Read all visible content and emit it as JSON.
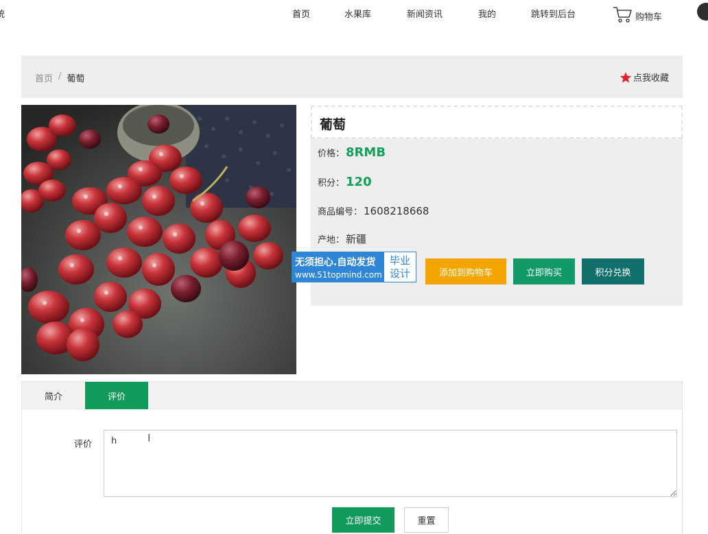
{
  "header": {
    "site_edge": "统",
    "nav": [
      {
        "label": "首页"
      },
      {
        "label": "水果库"
      },
      {
        "label": "新闻资讯"
      },
      {
        "label": "我的"
      },
      {
        "label": "跳转到后台"
      }
    ],
    "cart_label": "购物车",
    "cart_icon": "shopping-cart-icon"
  },
  "breadcrumb": {
    "home": "首页",
    "separator": "/",
    "current": "葡萄"
  },
  "favorite_label": "点我收藏",
  "product": {
    "name": "葡萄",
    "price_label": "价格：",
    "price": "8RMB",
    "points_label": "积分：",
    "points": "120",
    "code_label": "商品编号：",
    "code": "1608218668",
    "origin_label": "产地：",
    "origin": "新疆"
  },
  "actions": {
    "add_to_cart": "添加到购物车",
    "buy_now": "立即购买",
    "exchange": "积分兑换"
  },
  "watermark": {
    "line1": "无须担心.自动发货",
    "line2": "www.51topmind.com",
    "side_1": "毕业",
    "side_2": "设计"
  },
  "tabs": [
    {
      "label": "简介"
    },
    {
      "label": "评价"
    }
  ],
  "review_form": {
    "label": "评价",
    "value": "h",
    "submit": "立即提交",
    "reset": "重置"
  },
  "colors": {
    "accent_green": "#119a5a",
    "cart_orange": "#f5a500",
    "exchange_teal": "#11706b",
    "favorite_star": "#e4202a"
  }
}
